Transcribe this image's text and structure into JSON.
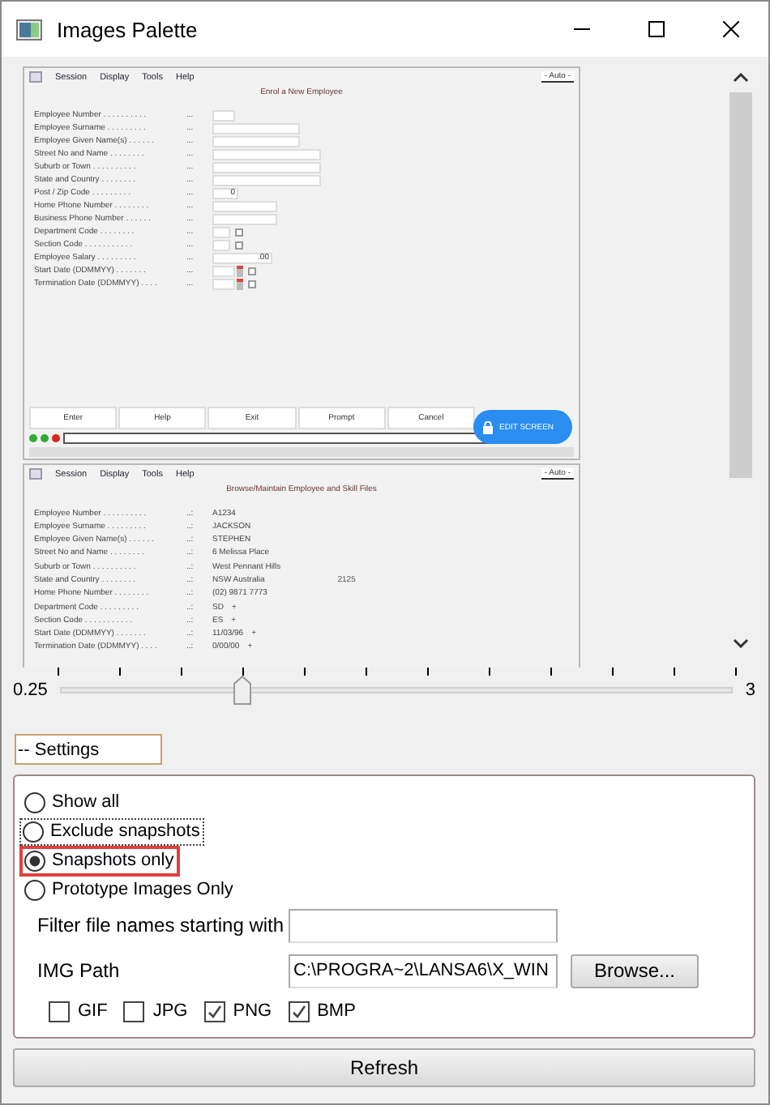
{
  "window": {
    "title": "Images Palette"
  },
  "preview": {
    "snapshots": [
      {
        "menu": [
          "Session",
          "Display",
          "Tools",
          "Help"
        ],
        "search": "- Auto -",
        "heading": "Enrol a New Employee",
        "sep": "...",
        "fields": [
          {
            "label": "Employee Number . . . . . . . . . .",
            "kind": "short"
          },
          {
            "label": "Employee Surname . . . . . . . . .",
            "kind": "medium"
          },
          {
            "label": "Employee Given Name(s) . . . . . .",
            "kind": "medium"
          },
          {
            "label": "Street No and Name . . . . . . . .",
            "kind": "long"
          },
          {
            "label": "Suburb or Town . . . . . . . . . .",
            "kind": "long"
          },
          {
            "label": "State and Country . . . . . . . .",
            "kind": "long"
          },
          {
            "label": "Post / Zip Code . . . . . . . . .",
            "kind": "number",
            "value": "0"
          },
          {
            "label": "Home Phone Number . . . . . . . .",
            "kind": "phone"
          },
          {
            "label": "Business Phone Number . . . . . .",
            "kind": "phone"
          },
          {
            "label": "Department Code . . . . . . . .",
            "kind": "code"
          },
          {
            "label": "Section Code . . . . . . . . . . .",
            "kind": "code"
          },
          {
            "label": "Employee Salary . . . . . . . . .",
            "kind": "salary",
            "value": ".00"
          },
          {
            "label": "Start Date (DDMMYY) . . . . . . .",
            "kind": "date"
          },
          {
            "label": "Termination Date (DDMMYY) . . . .",
            "kind": "date"
          }
        ],
        "buttons": [
          "Enter",
          "Help",
          "Exit",
          "Prompt",
          "Cancel"
        ],
        "badge": "EDIT SCREEN"
      },
      {
        "menu": [
          "Session",
          "Display",
          "Tools",
          "Help"
        ],
        "search": "- Auto -",
        "heading": "Browse/Maintain Employee and Skill Files",
        "sep": "..:",
        "fields": [
          {
            "label": "Employee Number . . . . . . . . . .",
            "kind": "text",
            "value": "A1234"
          },
          {
            "label": "Employee Surname . . . . . . . . .",
            "kind": "text",
            "value": "JACKSON"
          },
          {
            "label": "Employee Given Name(s) . . . . . .",
            "kind": "text",
            "value": "STEPHEN"
          },
          {
            "label": "Street No and Name . . . . . . . .",
            "kind": "text",
            "value": "6 Melissa Place"
          },
          {
            "label": "Suburb or Town . . . . . . . . . .",
            "kind": "text",
            "value": "West Pennant Hills"
          },
          {
            "label": "State and Country . . . . . . . .",
            "kind": "text",
            "value": "NSW Australia",
            "extra": "2125"
          },
          {
            "label": "Home Phone Number . . . . . . . .",
            "kind": "text",
            "value": "(02) 9871 7773"
          },
          {
            "label": "Department Code . . . . . . . . .",
            "kind": "text",
            "value": "SD",
            "extra": "+"
          },
          {
            "label": "Section Code . . . . . . . . . . .",
            "kind": "text",
            "value": "ES",
            "extra": "+"
          },
          {
            "label": "Start Date (DDMMYY) . . . . . . .",
            "kind": "text",
            "value": "11/03/96",
            "extra": "+"
          },
          {
            "label": "Termination Date (DDMMYY) . . . .",
            "kind": "text",
            "value": "0/00/00",
            "extra": "+"
          }
        ]
      }
    ]
  },
  "zoom": {
    "min": "0.25",
    "max": "3",
    "level": 0.27
  },
  "settings": {
    "title": "-- Settings",
    "options": [
      {
        "label": "Show all",
        "selected": false,
        "focused": false,
        "highlighted": false
      },
      {
        "label": "Exclude snapshots",
        "selected": false,
        "focused": true,
        "highlighted": false
      },
      {
        "label": "Snapshots only",
        "selected": true,
        "focused": false,
        "highlighted": true
      },
      {
        "label": "Prototype Images Only",
        "selected": false,
        "focused": false,
        "highlighted": false
      }
    ],
    "filter": {
      "label": "Filter file names starting with"
    },
    "img_path": {
      "label": "IMG Path",
      "value": "C:\\PROGRA~2\\LANSA6\\X_WIN"
    },
    "browse": "Browse...",
    "types": [
      {
        "label": "GIF",
        "checked": false
      },
      {
        "label": "JPG",
        "checked": false
      },
      {
        "label": "PNG",
        "checked": true
      },
      {
        "label": "BMP",
        "checked": true
      }
    ]
  },
  "refresh": "Refresh"
}
